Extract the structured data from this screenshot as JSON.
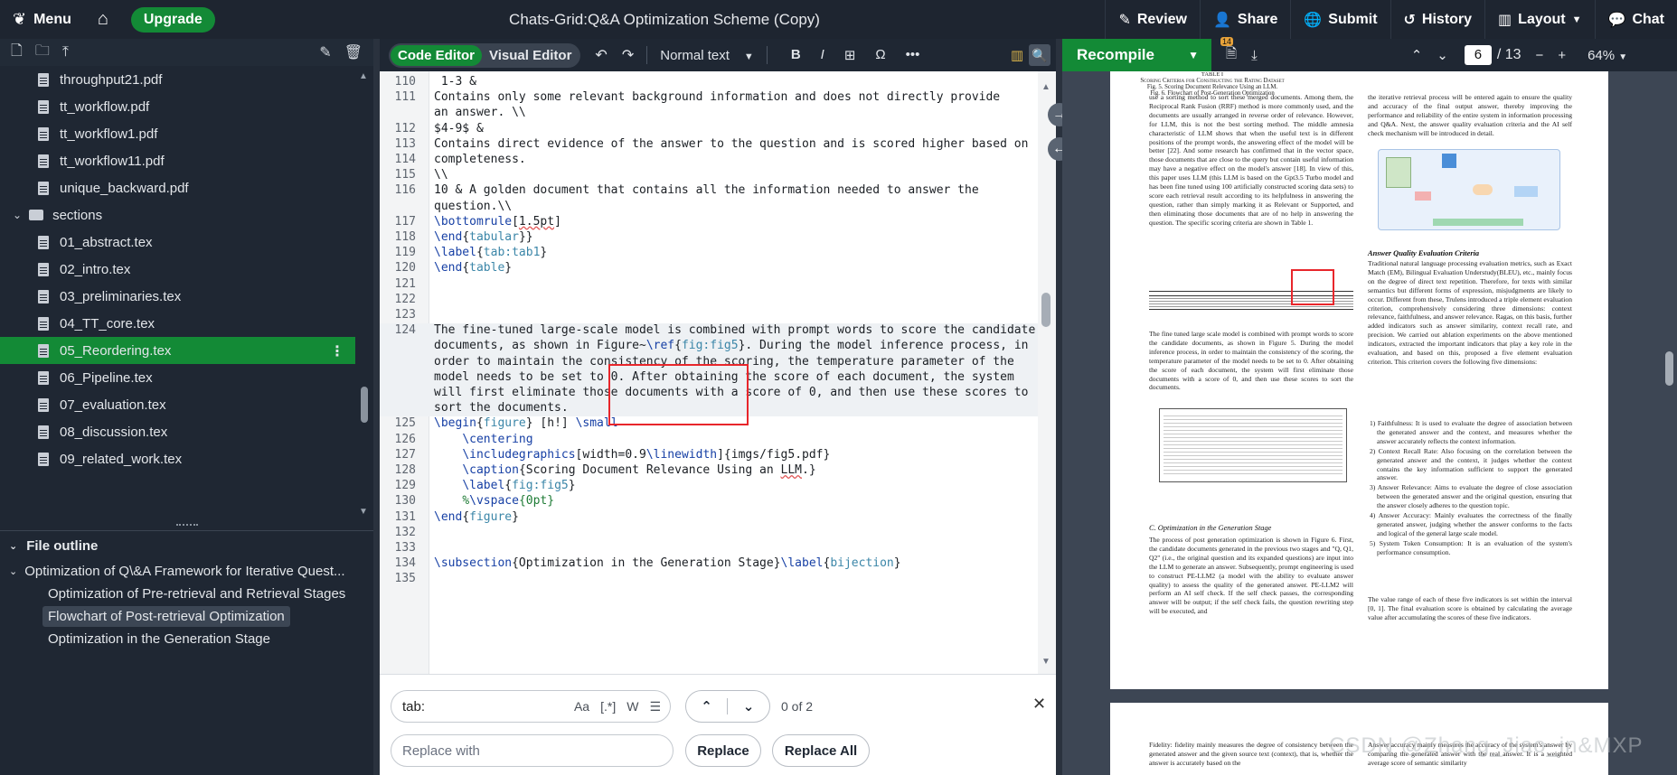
{
  "topbar": {
    "menu_label": "Menu",
    "upgrade_label": "Upgrade",
    "title": "Chats-Grid:Q&A Optimization Scheme (Copy)",
    "review_label": "Review",
    "share_label": "Share",
    "submit_label": "Submit",
    "history_label": "History",
    "layout_label": "Layout",
    "chat_label": "Chat"
  },
  "filetree": {
    "items": [
      {
        "type": "file",
        "name": "throughput21.pdf"
      },
      {
        "type": "file",
        "name": "tt_workflow.pdf"
      },
      {
        "type": "file",
        "name": "tt_workflow1.pdf"
      },
      {
        "type": "file",
        "name": "tt_workflow11.pdf"
      },
      {
        "type": "file",
        "name": "unique_backward.pdf"
      },
      {
        "type": "folder",
        "name": "sections"
      },
      {
        "type": "file",
        "name": "01_abstract.tex"
      },
      {
        "type": "file",
        "name": "02_intro.tex"
      },
      {
        "type": "file",
        "name": "03_preliminaries.tex"
      },
      {
        "type": "file",
        "name": "04_TT_core.tex"
      },
      {
        "type": "file",
        "name": "05_Reordering.tex",
        "active": true
      },
      {
        "type": "file",
        "name": "06_Pipeline.tex"
      },
      {
        "type": "file",
        "name": "07_evaluation.tex"
      },
      {
        "type": "file",
        "name": "08_discussion.tex"
      },
      {
        "type": "file",
        "name": "09_related_work.tex"
      }
    ]
  },
  "outline": {
    "title": "File outline",
    "root": "Optimization of Q\\&A Framework for Iterative Quest...",
    "children": [
      "Optimization of Pre-retrieval and Retrieval Stages",
      "Flowchart of Post-retrieval Optimization",
      "Optimization in the Generation Stage"
    ]
  },
  "editor": {
    "mode_code": "Code Editor",
    "mode_visual": "Visual Editor",
    "style_select": "Normal text",
    "lines": [
      {
        "n": "110",
        "t": " 1-3 &"
      },
      {
        "n": "111",
        "t": "Contains only some relevant background information and does not directly provide"
      },
      {
        "n": "",
        "t": "an answer. \\\\"
      },
      {
        "n": "112",
        "t": "$4-9$ &"
      },
      {
        "n": "113",
        "t": "Contains direct evidence of the answer to the question and is scored higher based on"
      },
      {
        "n": "114",
        "t": "completeness."
      },
      {
        "n": "115",
        "t": "\\\\"
      },
      {
        "n": "116",
        "t": "10 & A golden document that contains all the information needed to answer the"
      },
      {
        "n": "",
        "t": "question.\\\\"
      },
      {
        "n": "117",
        "t": "\\bottomrule[1.5pt]"
      },
      {
        "n": "118",
        "t": "\\end{tabular}}"
      },
      {
        "n": "119",
        "t": "\\label{tab:tab1}"
      },
      {
        "n": "120",
        "t": "\\end{table}"
      },
      {
        "n": "121",
        "t": ""
      },
      {
        "n": "122",
        "t": ""
      },
      {
        "n": "123",
        "t": ""
      },
      {
        "n": "124",
        "t": "The fine-tuned large-scale model is combined with prompt words to score the candidate"
      },
      {
        "n": "",
        "t": "documents, as shown in Figure~\\ref{fig:fig5}. During the model inference process, in"
      },
      {
        "n": "",
        "t": "order to maintain the consistency of the scoring, the temperature parameter of the"
      },
      {
        "n": "",
        "t": "model needs to be set to 0. After obtaining the score of each document, the system"
      },
      {
        "n": "",
        "t": "will first eliminate those documents with a score of 0, and then use these scores to"
      },
      {
        "n": "",
        "t": "sort the documents."
      },
      {
        "n": "125",
        "t": "\\begin{figure} [h!] \\small"
      },
      {
        "n": "126",
        "t": "    \\centering"
      },
      {
        "n": "127",
        "t": "    \\includegraphics[width=0.9\\linewidth]{imgs/fig5.pdf}"
      },
      {
        "n": "128",
        "t": "    \\caption{Scoring Document Relevance Using an LLM.}"
      },
      {
        "n": "129",
        "t": "    \\label{fig:fig5}"
      },
      {
        "n": "130",
        "t": "    %\\vspace{0pt}"
      },
      {
        "n": "131",
        "t": "\\end{figure}"
      },
      {
        "n": "132",
        "t": ""
      },
      {
        "n": "133",
        "t": ""
      },
      {
        "n": "134",
        "t": "\\subsection{Optimization in the Generation Stage}\\label{bijection}"
      },
      {
        "n": "135",
        "t": ""
      }
    ]
  },
  "find": {
    "query": "tab:",
    "opt_case": "Aa",
    "opt_regex": "[.*]",
    "opt_word": "W",
    "count": "0 of 2",
    "replace_placeholder": "Replace with",
    "replace_label": "Replace",
    "replace_all_label": "Replace All"
  },
  "pdf": {
    "recompile_label": "Recompile",
    "badge": "14",
    "page": "6",
    "total": "/ 13",
    "zoom": "64%",
    "left_col_top": "use a sorting method to sort these merged documents. Among them, the Reciprocal Rank Fusion (RRF) method is more commonly used, and the documents are usually arranged in reverse order of relevance. However, for LLM, this is not the best sorting method. The middle amnesia characteristic of LLM shows that when the useful text is in different positions of the prompt words, the answering effect of the model will be better [22]. And some research has confirmed that in the vector space, those documents that are close to the query but contain useful information may have a negative effect on the model's answer [18]. In view of this, this paper uses LLM (this LLM is based on the Gpt3.5 Turbo model and has been fine tuned using 100 artificially constructed scoring data sets) to score each retrieval result according to its helpfulness in answering the question, rather than simply marking it as Relevant or Supported, and then eliminating those documents that are of no help in answering the question. The specific scoring criteria are shown in Table 1.",
    "table_title": "TABLE I",
    "table_caption": "Scoring Criteria for Constructing the Rating Dataset",
    "left_col_mid": "The fine tuned large scale model is combined with prompt words to score the candidate documents, as shown in Figure 5. During the model inference process, in order to maintain the consistency of the scoring, the temperature parameter of the model needs to be set to 0. After obtaining the score of each document, the system will first eliminate those documents with a score of 0, and then use these scores to sort the documents.",
    "fig5_caption": "Fig. 5.  Scoring Document Relevance Using an LLM.",
    "sec_c": "C. Optimization in the Generation Stage",
    "left_col_bot": "The process of post generation optimization is shown in Figure 6. First, the candidate documents generated in the previous two stages and \"Q, Q1, Q2\" (i.e., the original question and its expanded questions) are input into the LLM to generate an answer. Subsequently, prompt engineering is used to construct PE-LLM2 (a model with the ability to evaluate answer quality) to assess the quality of the generated answer. PE-LLM2 will perform an AI self check. If the self check passes, the corresponding answer will be output; if the self check fails, the question rewriting step will be executed, and",
    "right_col_top": "the iterative retrieval process will be entered again to ensure the quality and accuracy of the final output answer, thereby improving the performance and reliability of the entire system in information processing and Q&A. Next, the answer quality evaluation criteria and the AI self check mechanism will be introduced in detail.",
    "fig6_caption": "Fig. 6.  Flowchart of Post-Generation Optimization",
    "sec_answer": "Answer Quality Evaluation Criteria",
    "right_col_mid": "Traditional natural language processing evaluation metrics, such as Exact Match (EM), Bilingual Evaluation Understudy(BLEU), etc., mainly focus on the degree of direct text repetition. Therefore, for texts with similar semantics but different forms of expression, misjudgments are likely to occur. Different from these, Trulens introduced a triple element evaluation criterion, comprehensively considering three dimensions: context relevance, faithfulness, and answer relevance. Ragas, on this basis, further added indicators such as answer similarity, context recall rate, and precision. We carried out ablation experiments on the above mentioned indicators, extracted the important indicators that play a key role in the evaluation, and based on this, proposed a five element evaluation criterion. This criterion covers the following five dimensions:",
    "list": [
      "1) Faithfulness: It is used to evaluate the degree of association between the generated answer and the context, and measures whether the answer accurately reflects the context information.",
      "2) Context Recall Rate: Also focusing on the correlation between the generated answer and the context, it judges whether the context contains the key information sufficient to support the generated answer.",
      "3) Answer Relevance: Aims to evaluate the degree of close association between the generated answer and the original question, ensuring that the answer closely adheres to the question topic.",
      "4) Answer Accuracy: Mainly evaluates the correctness of the finally generated answer, judging whether the answer conforms to the facts and logical of the general large scale model.",
      "5) System Token Consumption: It is an evaluation of the system's performance consumption."
    ],
    "right_col_bot": "The value range of each of these five indicators is set within the interval [0, 1]. The final evaluation score is obtained by calculating the average value after accumulating the scores of these five indicators.",
    "page2_left": "Fidelity: fidelity mainly measures the degree of consistency between the generated answer and the given source text (context), that is, whether the answer is accurately based on the",
    "page2_right": "Answer accuracy mainly measures the accuracy of the system's answer by comparing the generated answer with the real answer. It is a weighted average score of semantic similarity"
  },
  "watermark": "CSDN @Zhang_Jiao_in&MXP"
}
